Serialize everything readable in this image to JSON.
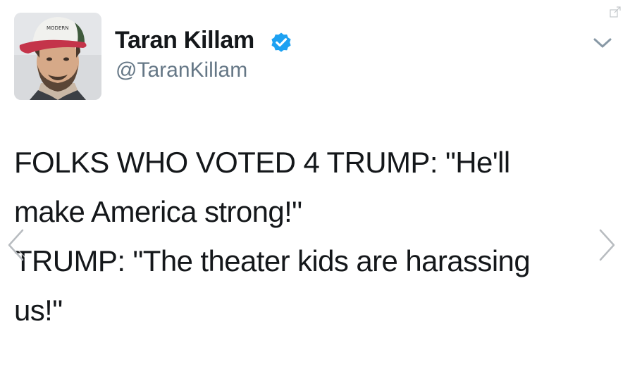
{
  "tweet": {
    "author": {
      "display_name": "Taran Killam",
      "username": "@TaranKillam",
      "verified": true,
      "avatar_icon": "profile-photo"
    },
    "text_lines": [
      "FOLKS WHO VOTED 4 TRUMP: \"He'll",
      "make America strong!\"",
      "TRUMP: \"The theater kids are harassing",
      "us!\""
    ]
  },
  "icons": {
    "verified": "verified-badge-icon",
    "menu": "chevron-down-icon",
    "expand": "expand-icon",
    "prev": "chevron-left-icon",
    "next": "chevron-right-icon"
  },
  "colors": {
    "verified_blue": "#1da1f2",
    "text": "#14171a",
    "secondary_text": "#657786",
    "nav_arrow": "#b8bcc0"
  }
}
